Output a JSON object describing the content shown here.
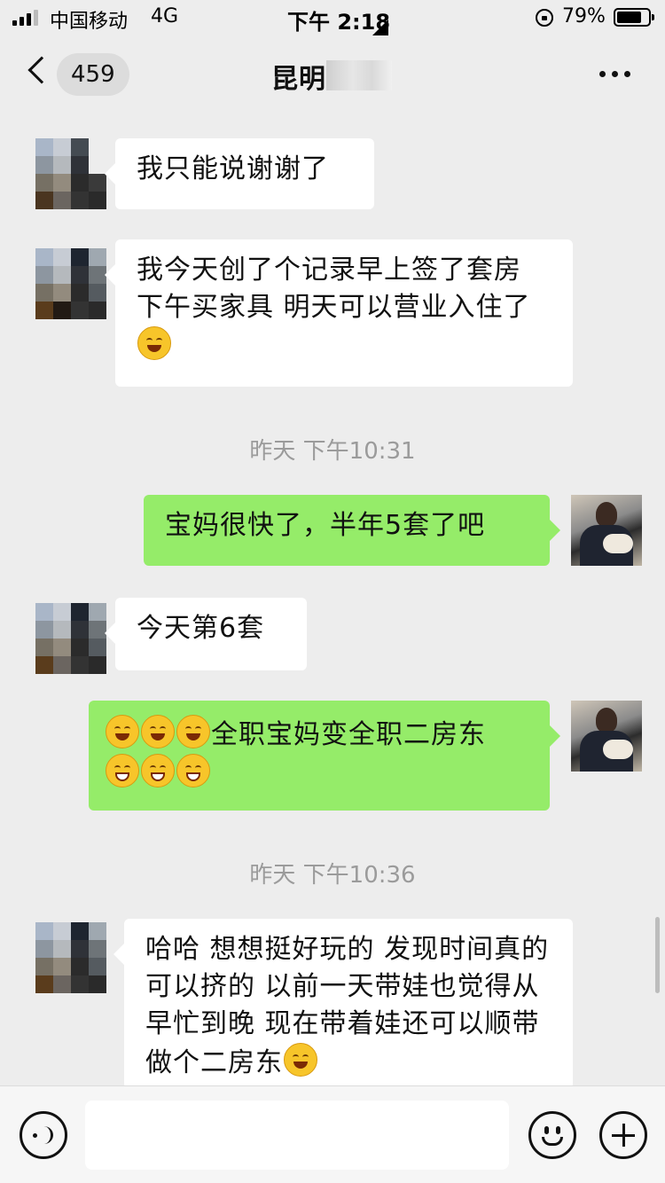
{
  "status_bar": {
    "carrier": "中国移动",
    "network": "4G",
    "time": "下午 2:18",
    "battery_percent": "79%",
    "battery_level": 0.79
  },
  "header": {
    "back_count": "459",
    "title": "昆明"
  },
  "messages": [
    {
      "side": "in",
      "text": "我只能说谢谢了"
    },
    {
      "side": "in",
      "text": "我今天创了个记录早上签了套房 下午买家具 明天可以营业入住了",
      "emoji": "laughing-tears"
    },
    {
      "type": "timestamp",
      "text": "昨天 下午10:31"
    },
    {
      "side": "out",
      "text": "宝妈很快了，半年5套了吧"
    },
    {
      "side": "in",
      "text": "今天第6套"
    },
    {
      "side": "out",
      "text": "全职宝妈变全职二房东",
      "emoji": [
        "smiling-face",
        "smiling-face",
        "smiling-face",
        "grinning-face",
        "grinning-face",
        "grinning-face"
      ]
    },
    {
      "type": "timestamp",
      "text": "昨天 下午10:36"
    },
    {
      "side": "in",
      "text": "哈哈 想想挺好玩的 发现时间真的可以挤的 以前一天带娃也觉得从早忙到晚 现在带着娃还可以顺带做个二房东",
      "emoji": "face-with-hand-over-mouth"
    }
  ],
  "input": {
    "placeholder": ""
  },
  "colors": {
    "background": "#ededed",
    "incoming_bubble": "#ffffff",
    "outgoing_bubble": "#95ec69",
    "timestamp": "#9b9b9b"
  }
}
